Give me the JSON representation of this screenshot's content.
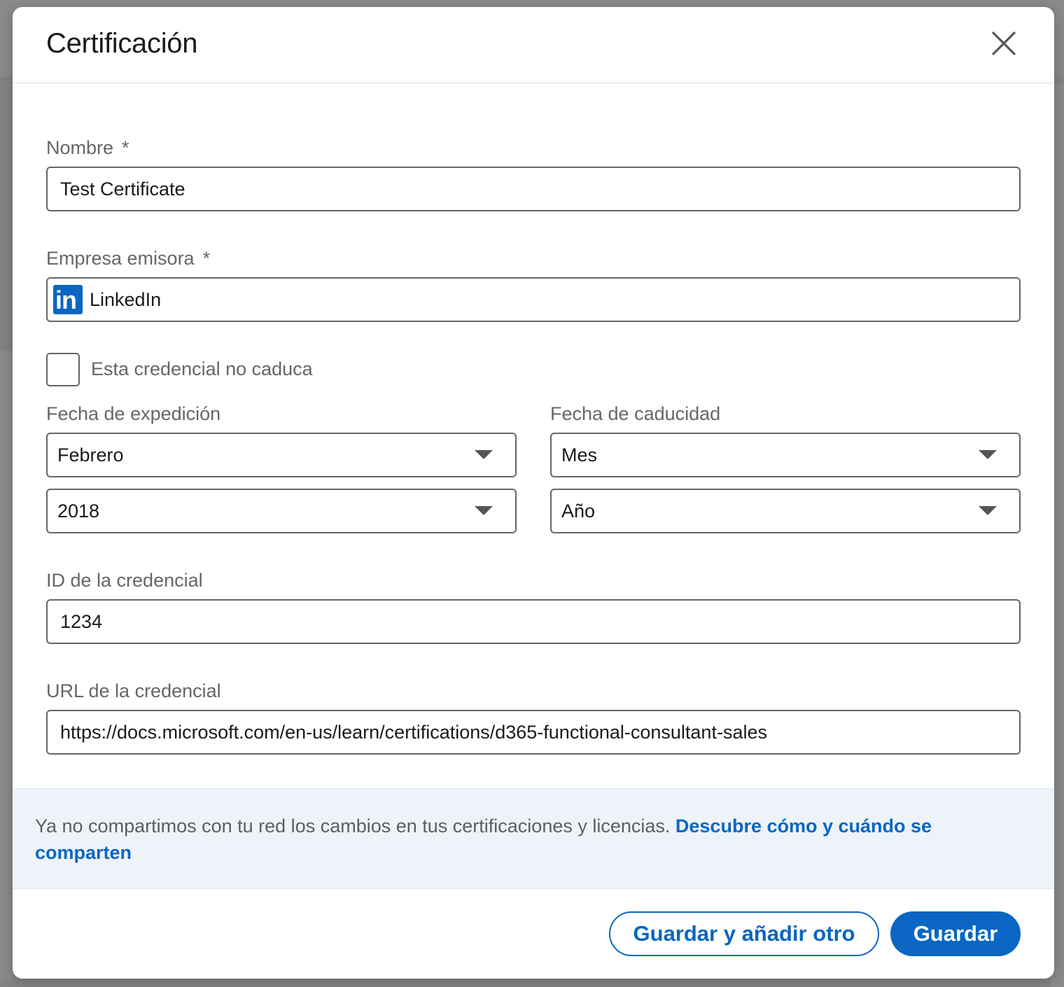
{
  "modal": {
    "title": "Certificación",
    "close_icon": "close-icon"
  },
  "form": {
    "name": {
      "label": "Nombre",
      "required_mark": "*",
      "value": "Test Certificate"
    },
    "issuer": {
      "label": "Empresa emisora",
      "required_mark": "*",
      "logo_text": "in",
      "value": "LinkedIn"
    },
    "no_expiry": {
      "label": "Esta credencial no caduca",
      "checked": false
    },
    "issue_date": {
      "label": "Fecha de expedición",
      "month": "Febrero",
      "year": "2018"
    },
    "expiry_date": {
      "label": "Fecha de caducidad",
      "month": "Mes",
      "year": "Año"
    },
    "credential_id": {
      "label": "ID de la credencial",
      "value": "1234"
    },
    "credential_url": {
      "label": "URL de la credencial",
      "value": "https://docs.microsoft.com/en-us/learn/certifications/d365-functional-consultant-sales"
    }
  },
  "notice": {
    "text": "Ya no compartimos con tu red los cambios en tus certificaciones y licencias. ",
    "link": "Descubre cómo y cuándo se comparten"
  },
  "buttons": {
    "save_and_add": "Guardar y añadir otro",
    "save": "Guardar"
  },
  "colors": {
    "accent": "#0a66c2",
    "notice_bg": "#edf3f8",
    "border": "#666666"
  }
}
